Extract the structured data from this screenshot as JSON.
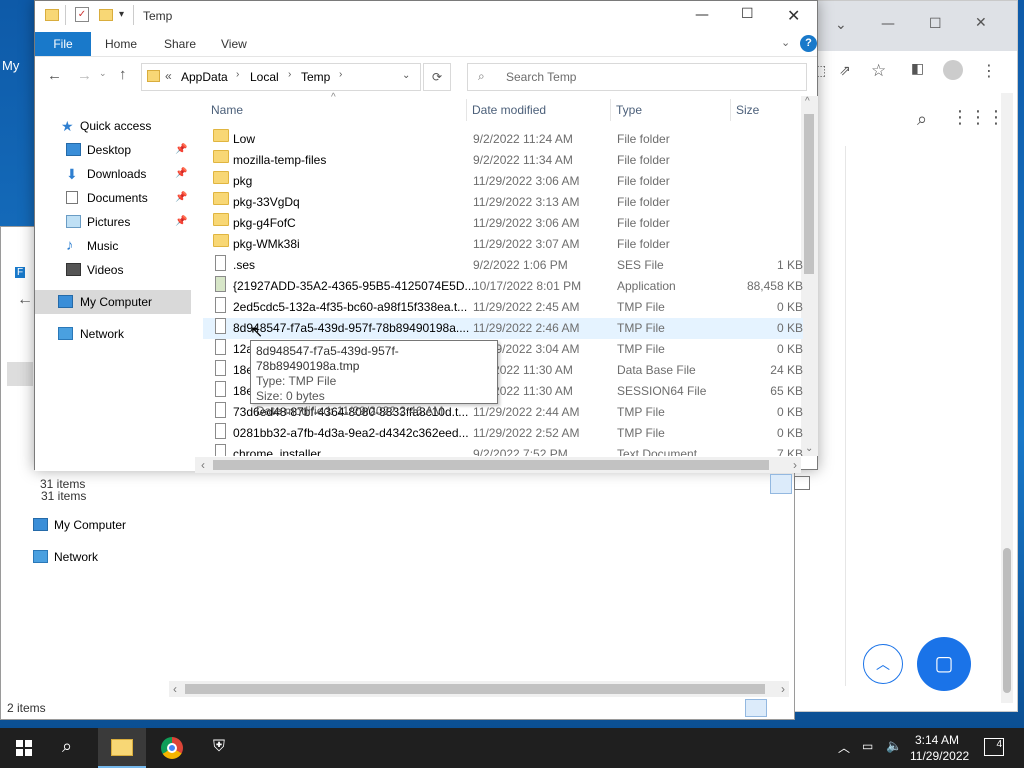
{
  "explorer": {
    "title": "Temp",
    "ribbon_tabs": [
      "File",
      "Home",
      "Share",
      "View"
    ],
    "breadcrumb": [
      "AppData",
      "Local",
      "Temp"
    ],
    "breadcrumb_overflow": "«",
    "search_placeholder": "Search Temp",
    "columns": {
      "name": "Name",
      "date": "Date modified",
      "type": "Type",
      "size": "Size"
    },
    "nav": [
      {
        "label": "Quick access",
        "icon": "star-icon"
      },
      {
        "label": "Desktop",
        "icon": "desktop-icon",
        "pinned": true
      },
      {
        "label": "Downloads",
        "icon": "download-icon",
        "pinned": true
      },
      {
        "label": "Documents",
        "icon": "document-icon",
        "pinned": true
      },
      {
        "label": "Pictures",
        "icon": "picture-icon",
        "pinned": true
      },
      {
        "label": "Music",
        "icon": "music-icon"
      },
      {
        "label": "Videos",
        "icon": "video-icon"
      },
      {
        "label": "My Computer",
        "icon": "computer-icon"
      },
      {
        "label": "Network",
        "icon": "network-icon"
      }
    ],
    "files": [
      {
        "name": "Low",
        "date": "9/2/2022 11:24 AM",
        "type": "File folder",
        "size": "",
        "kind": "folder"
      },
      {
        "name": "mozilla-temp-files",
        "date": "9/2/2022 11:34 AM",
        "type": "File folder",
        "size": "",
        "kind": "folder"
      },
      {
        "name": "pkg",
        "date": "11/29/2022 3:06 AM",
        "type": "File folder",
        "size": "",
        "kind": "folder"
      },
      {
        "name": "pkg-33VgDq",
        "date": "11/29/2022 3:13 AM",
        "type": "File folder",
        "size": "",
        "kind": "folder"
      },
      {
        "name": "pkg-g4FofC",
        "date": "11/29/2022 3:06 AM",
        "type": "File folder",
        "size": "",
        "kind": "folder"
      },
      {
        "name": "pkg-WMk38i",
        "date": "11/29/2022 3:07 AM",
        "type": "File folder",
        "size": "",
        "kind": "folder"
      },
      {
        "name": ".ses",
        "date": "9/2/2022 1:06 PM",
        "type": "SES File",
        "size": "1 KB",
        "kind": "file"
      },
      {
        "name": "{21927ADD-35A2-4365-95B5-4125074E5D...",
        "date": "10/17/2022 8:01 PM",
        "type": "Application",
        "size": "88,458 KB",
        "kind": "app"
      },
      {
        "name": "2ed5cdc5-132a-4f35-bc60-a98f15f338ea.t...",
        "date": "11/29/2022 2:45 AM",
        "type": "TMP File",
        "size": "0 KB",
        "kind": "file"
      },
      {
        "name": "8d948547-f7a5-439d-957f-78b89490198a....",
        "date": "11/29/2022 2:46 AM",
        "type": "TMP File",
        "size": "0 KB",
        "kind": "file",
        "hover": true
      },
      {
        "name": "12a",
        "date": "11/29/2022 3:04 AM",
        "type": "TMP File",
        "size": "0 KB",
        "kind": "file"
      },
      {
        "name": "18e",
        "date": "9/2/2022 11:30 AM",
        "type": "Data Base File",
        "size": "24 KB",
        "kind": "file"
      },
      {
        "name": "18e",
        "date": "9/2/2022 11:30 AM",
        "type": "SESSION64 File",
        "size": "65 KB",
        "kind": "file"
      },
      {
        "name": "73d6ed48-87bf-4364-8080-8833ffa8c10d.t...",
        "date": "11/29/2022 2:44 AM",
        "type": "TMP File",
        "size": "0 KB",
        "kind": "file"
      },
      {
        "name": "0281bb32-a7fb-4d3a-9ea2-d4342c362eed...",
        "date": "11/29/2022 2:52 AM",
        "type": "TMP File",
        "size": "0 KB",
        "kind": "file"
      },
      {
        "name": "chrome_installer",
        "date": "9/2/2022 7:52 PM",
        "type": "Text Document",
        "size": "7 KB",
        "kind": "file"
      }
    ],
    "status": "31 items",
    "tooltip": {
      "name": "8d948547-f7a5-439d-957f-78b89490198a.tmp",
      "type": "Type: TMP File",
      "size": "Size: 0 bytes",
      "date": "Date modified: 11/29/2022 2:46 AM"
    }
  },
  "back_window": {
    "nav": [
      {
        "label": "My Computer",
        "icon": "computer-icon"
      },
      {
        "label": "Network",
        "icon": "network-icon"
      }
    ],
    "status": "2 items"
  },
  "taskbar": {
    "time": "3:14 AM",
    "date": "11/29/2022",
    "notifications": "4"
  },
  "desktop_text": "My",
  "colors": {
    "accent": "#1979ca",
    "folder": "#f8d775",
    "taskbar": "#1f1f1f",
    "hover_row": "#e5f3ff"
  }
}
